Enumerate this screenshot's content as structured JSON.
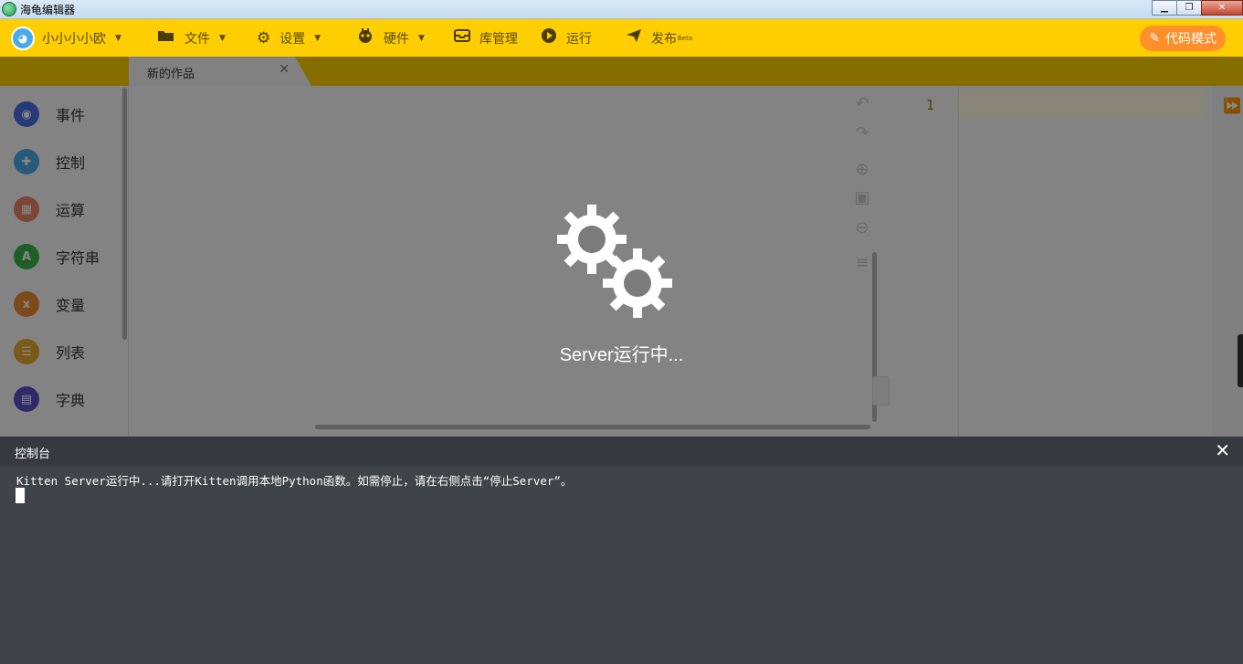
{
  "window": {
    "title": "海龟编辑器"
  },
  "topbar": {
    "username": "小小小小欧",
    "menu": [
      {
        "label": "文件",
        "icon": "folder-icon"
      },
      {
        "label": "设置",
        "icon": "gear-icon"
      },
      {
        "label": "硬件",
        "icon": "robot-icon"
      },
      {
        "label": "库管理",
        "icon": "inbox-icon"
      },
      {
        "label": "运行",
        "icon": "play-icon"
      },
      {
        "label": "发布",
        "icon": "send-icon",
        "badge": "Beta"
      }
    ],
    "code_mode_label": "代码模式"
  },
  "tab": {
    "label": "新的作品"
  },
  "sidebar": {
    "categories": [
      {
        "label": "事件",
        "color": "#4a6fe0",
        "icon": "toggle-icon"
      },
      {
        "label": "控制",
        "color": "#4aa9e9",
        "icon": "gamepad-icon"
      },
      {
        "label": "运算",
        "color": "#e9826a",
        "icon": "grid-icon"
      },
      {
        "label": "字符串",
        "color": "#3ab34a",
        "icon": "letter-a-icon"
      },
      {
        "label": "变量",
        "color": "#ed8b2e",
        "icon": "x-variable-icon"
      },
      {
        "label": "列表",
        "color": "#e8a92d",
        "icon": "list-icon"
      },
      {
        "label": "字典",
        "color": "#5a4fc9",
        "icon": "book-icon"
      }
    ]
  },
  "editor": {
    "line_numbers": [
      "1"
    ]
  },
  "overlay": {
    "text": "Server运行中..."
  },
  "console": {
    "title": "控制台",
    "line": "Kitten Server运行中...请打开Kitten调用本地Python函数。如需停止，请在右侧点击“停止Server”。"
  }
}
